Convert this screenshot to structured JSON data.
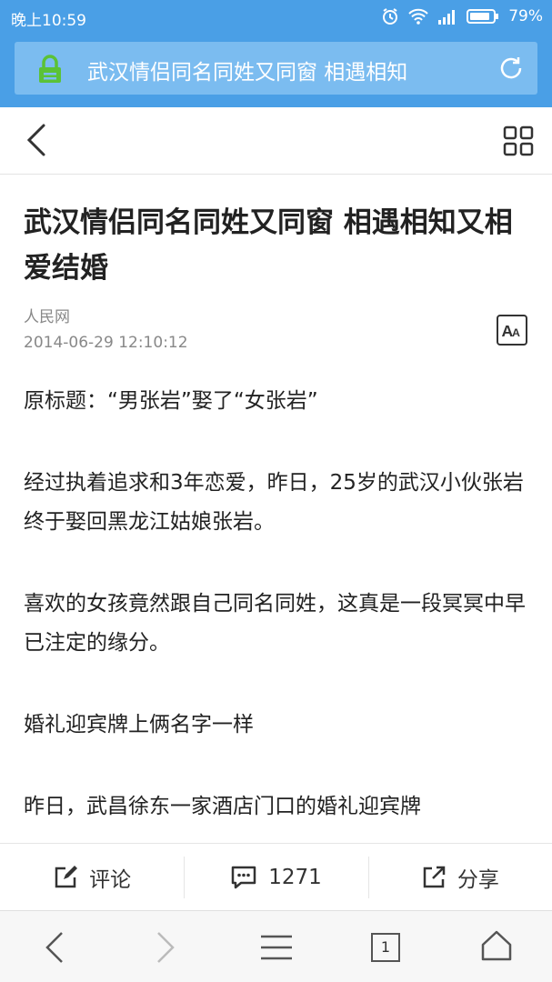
{
  "status_bar": {
    "time": "晚上10:59",
    "battery": "79%",
    "icons": [
      "alarm-icon",
      "wifi-icon",
      "signal-icon",
      "battery-icon"
    ]
  },
  "url_bar": {
    "text": "武汉情侣同名同姓又同窗 相遇相知",
    "lock_color": "#5bc236"
  },
  "article": {
    "title": "武汉情侣同名同姓又同窗 相遇相知又相爱结婚",
    "source": "人民网",
    "date": "2014-06-29 12:10:12",
    "paragraphs": [
      "原标题：“男张岩”娶了“女张岩”",
      "经过执着追求和3年恋爱，昨日，25岁的武汉小伙张岩终于娶回黑龙江姑娘张岩。",
      "喜欢的女孩竟然跟自己同名同姓，这真是一段冥冥中早已注定的缘分。",
      "婚礼迎宾牌上俩名字一样",
      "昨日，武昌徐东一家酒店门口的婚礼迎宾牌"
    ]
  },
  "actions": {
    "comment_label": "评论",
    "comment_count": "1271",
    "share_label": "分享"
  },
  "browser": {
    "tab_count": "1"
  },
  "colors": {
    "accent": "#4a9fe6"
  }
}
